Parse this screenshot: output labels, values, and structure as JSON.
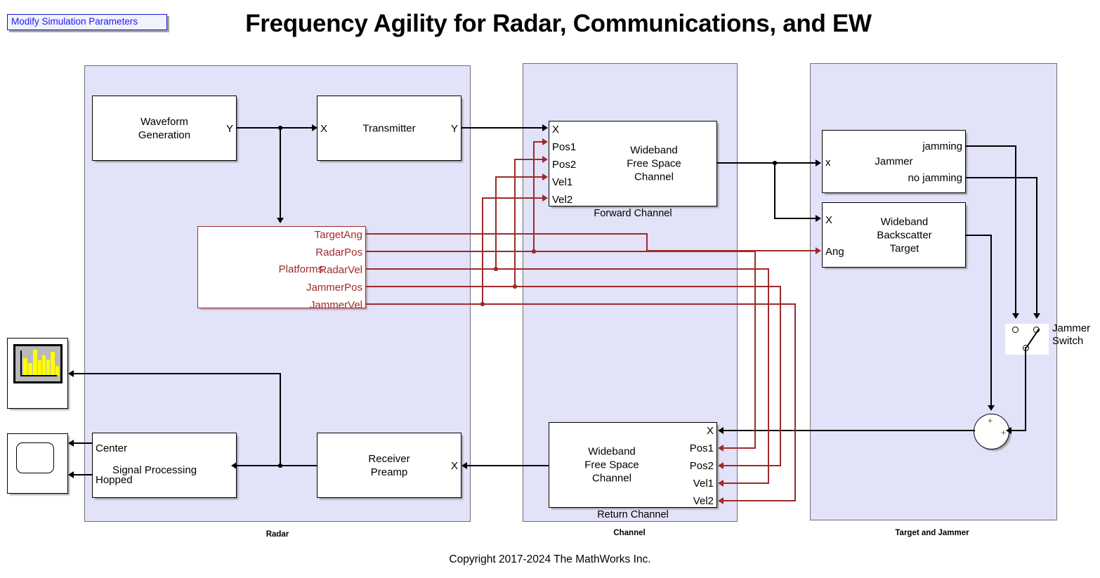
{
  "header": {
    "modify_button_label": "Modify Simulation Parameters",
    "title": "Frequency Agility for Radar, Communications, and EW",
    "copyright": "Copyright 2017-2024 The MathWorks Inc."
  },
  "colors": {
    "subsystem_fill": "#e2e2f8",
    "subsystem_border": "#6e6e78",
    "signal_black": "#000000",
    "signal_red": "#9e2a2a",
    "annotation_blue": "#1a1aff",
    "spectrum_bars": "#ffff00",
    "spectrum_screen": "#b9b9b9"
  },
  "subsystems": [
    {
      "name": "radar",
      "label": "Radar"
    },
    {
      "name": "channel",
      "label": "Channel"
    },
    {
      "name": "target_jammer",
      "label": "Target and Jammer"
    }
  ],
  "blocks": {
    "waveform_generation": {
      "title": "Waveform\nGeneration",
      "title_line1": "Waveform",
      "title_line2": "Generation",
      "out_ports": [
        "Y"
      ]
    },
    "transmitter": {
      "title": "Transmitter",
      "in_ports": [
        "X"
      ],
      "out_ports": [
        "Y"
      ]
    },
    "platforms": {
      "title": "Platforms",
      "out_ports": [
        "TargetAng",
        "RadarPos",
        "RadarVel",
        "JammerPos",
        "JammerVel"
      ]
    },
    "receiver_preamp": {
      "title": "Receiver\nPreamp",
      "title_line1": "Receiver",
      "title_line2": "Preamp",
      "in_ports": [
        "X"
      ]
    },
    "signal_processing": {
      "title": "Signal Processing",
      "out_ports": [
        "Center",
        "Hopped"
      ]
    },
    "forward_channel": {
      "title_line1": "Wideband",
      "title_line2": "Free Space",
      "title_line3": "Channel",
      "caption": "Forward Channel",
      "in_ports": [
        "X",
        "Pos1",
        "Pos2",
        "Vel1",
        "Vel2"
      ]
    },
    "return_channel": {
      "title_line1": "Wideband",
      "title_line2": "Free Space",
      "title_line3": "Channel",
      "caption": "Return Channel",
      "in_ports": [
        "X",
        "Pos1",
        "Pos2",
        "Vel1",
        "Vel2"
      ]
    },
    "jammer": {
      "title": "Jammer",
      "in_ports": [
        "x"
      ],
      "out_ports": [
        "jamming",
        "no jamming"
      ]
    },
    "backscatter_target": {
      "title_line1": "Wideband",
      "title_line2": "Backscatter",
      "title_line3": "Target",
      "in_ports": [
        "X",
        "Ang"
      ]
    },
    "jammer_switch": {
      "caption_line1": "Jammer",
      "caption_line2": "Switch"
    },
    "sum_block": {
      "sign_top": "+",
      "sign_right": "+"
    },
    "spectrum_scope": {
      "icon": "spectrum-analyzer-icon"
    },
    "time_scope": {
      "icon": "scope-icon"
    }
  }
}
